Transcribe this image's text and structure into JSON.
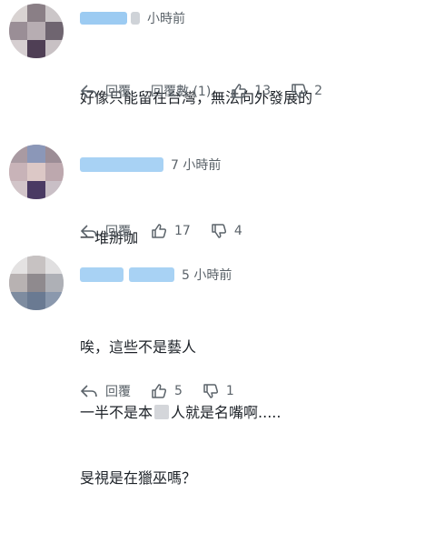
{
  "comments": [
    {
      "time": "小時前",
      "lines": [
        "好像只能留在台灣，無法向外發展的"
      ],
      "reply_label": "回覆",
      "replies_label": "回覆數 (1)",
      "likes": "13",
      "dislikes": "2"
    },
    {
      "time": "7 小時前",
      "lines": [
        "一堆掰咖"
      ],
      "reply_label": "回覆",
      "likes": "17",
      "dislikes": "4"
    },
    {
      "time": "5 小時前",
      "lines": [
        "唉，這些不是藝人",
        "一半不是本",
        "人就是名嘴啊.....",
        "旻視是在獵巫嗎？"
      ],
      "reply_label": "回覆",
      "likes": "5",
      "dislikes": "1"
    }
  ],
  "icons": {
    "reply": "reply-arrow-icon",
    "like": "thumbs-up-icon",
    "dislike": "thumbs-down-icon"
  },
  "colors": {
    "name_blur": "#8ec4f0",
    "muted_text": "#5b636a"
  }
}
